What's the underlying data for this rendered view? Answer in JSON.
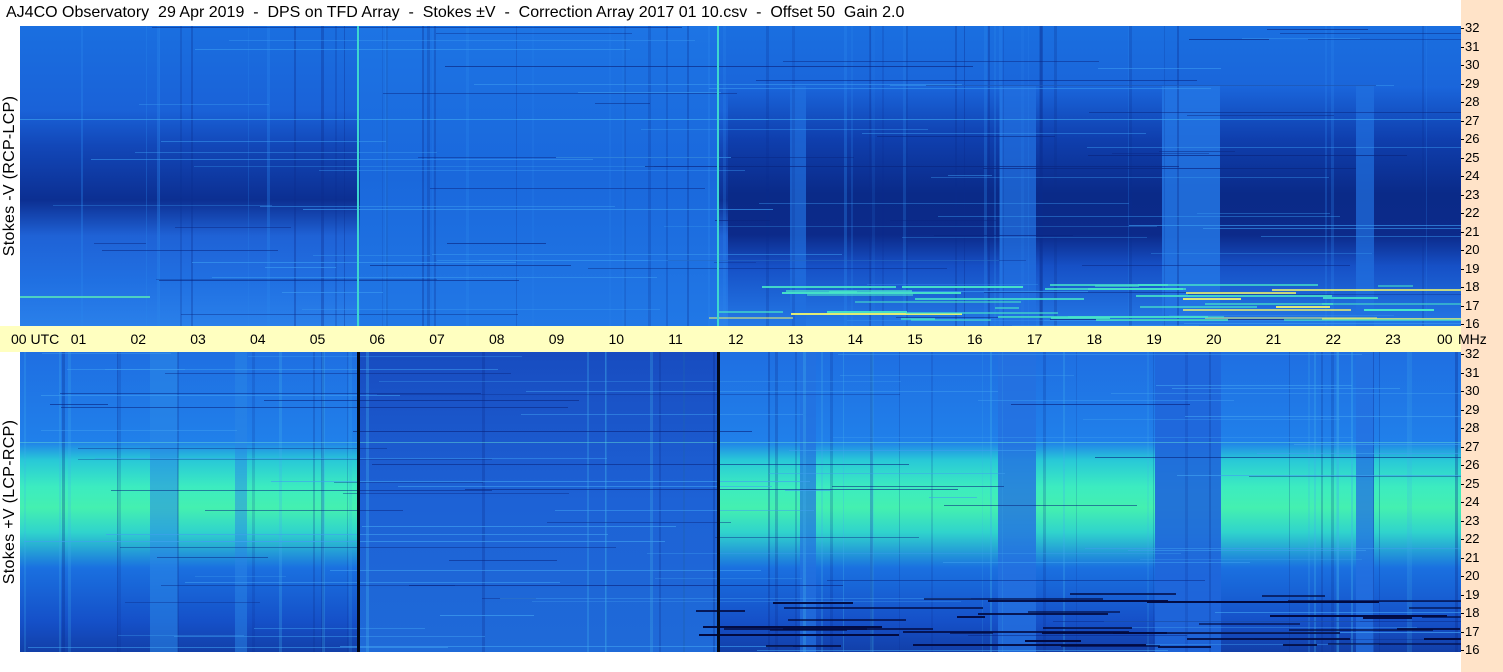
{
  "title": "AJ4CO Observatory  29 Apr 2019  -  DPS on TFD Array  -  Stokes ±V  -  Correction Array 2017 01 10.csv  -  Offset 50  Gain 2.0",
  "panels": {
    "top": {
      "ylabel": "Stokes -V (RCP-LCP)"
    },
    "bottom": {
      "ylabel": "Stokes +V (LCP-RCP)"
    }
  },
  "time_axis": {
    "labels": [
      "00 UTC",
      "01",
      "02",
      "03",
      "04",
      "05",
      "06",
      "07",
      "08",
      "09",
      "10",
      "11",
      "12",
      "13",
      "14",
      "15",
      "16",
      "17",
      "18",
      "19",
      "20",
      "21",
      "22",
      "23",
      "00"
    ],
    "unit": "MHz"
  },
  "freq_axis": {
    "labels": [
      "32",
      "31",
      "30",
      "29",
      "28",
      "27",
      "26",
      "25",
      "24",
      "23",
      "22",
      "21",
      "20",
      "19",
      "18",
      "17",
      "16"
    ]
  },
  "colors": {
    "axis_band": "#ffffc0",
    "side_strip": "#ffe3c8",
    "spectrogram_low": "#0a2a9a",
    "spectrogram_mid": "#1f6ce6",
    "spectrogram_high": "#3cf0c8"
  }
}
